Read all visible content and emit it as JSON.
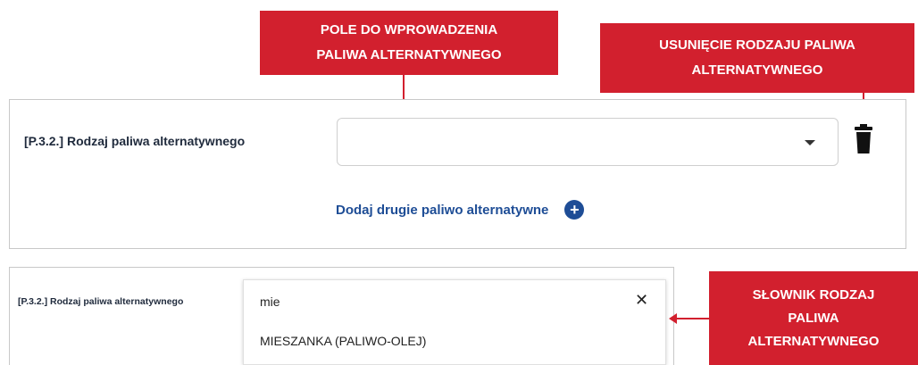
{
  "callouts": {
    "field_title_line1": "POLE DO WPROWADZENIA",
    "field_title_line2": "PALIWA ALTERNATYWNEGO",
    "delete_title_line1": "USUNIĘCIE RODZAJU PALIWA",
    "delete_title_line2": "ALTERNATYWNEGO",
    "dictionary_line1": "SŁOWNIK RODZAJ",
    "dictionary_line2": "PALIWA",
    "dictionary_line3": "ALTERNATYWNEGO"
  },
  "form": {
    "field_label": "[P.3.2.] Rodzaj paliwa alternatywnego",
    "select_value": "",
    "add_second_fuel_label": "Dodaj drugie paliwo alternatywne"
  },
  "dictionary": {
    "field_label": "[P.3.2.] Rodzaj paliwa alternatywnego",
    "search_value": "mie",
    "options": [
      "MIESZANKA (PALIWO-OLEJ)"
    ]
  },
  "colors": {
    "callout_red": "#d2202e",
    "link_blue": "#1e4d96"
  },
  "icons": {
    "delete": "trash-icon",
    "dropdown": "caret-down-icon",
    "add": "plus-circle-icon",
    "clear": "close-icon"
  }
}
